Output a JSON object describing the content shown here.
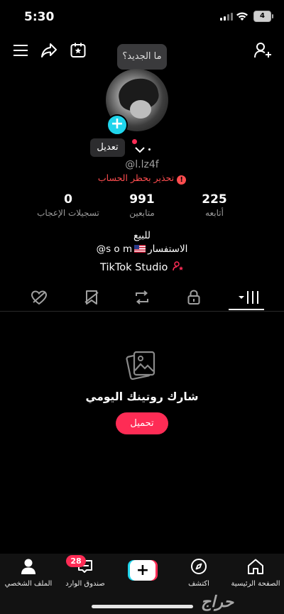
{
  "status_bar": {
    "time": "5:30",
    "battery": "4"
  },
  "tooltip": "ما الجديد؟",
  "profile": {
    "edit_label": "تعديل",
    "username": "@l.lz4f",
    "warning": "تحذير بحظر الحساب"
  },
  "stats": {
    "likes": {
      "value": "0",
      "label": "تسجيلات الإعجاب"
    },
    "followers": {
      "value": "991",
      "label": "متابعين"
    },
    "following": {
      "value": "225",
      "label": "أتابعه"
    }
  },
  "bio": {
    "line1": "للبيع",
    "line2_left": "@s o m",
    "line2_right": "الاستفسار",
    "studio": "TikTok Studio"
  },
  "tabs": [
    "videos",
    "private",
    "reposts",
    "favorites",
    "liked"
  ],
  "empty_state": {
    "title": "شارك روتينك اليومي",
    "button": "تحميل"
  },
  "bottom_nav": {
    "profile": "الملف الشخصي",
    "inbox": "صندوق الوارد",
    "inbox_badge": "28",
    "explore": "اكتشف",
    "home": "الصفحة الرئيسية"
  },
  "watermark": "حراج",
  "colors": {
    "accent": "#fe2c55",
    "cyan": "#20d5ec",
    "warning": "#ff4d4f"
  }
}
